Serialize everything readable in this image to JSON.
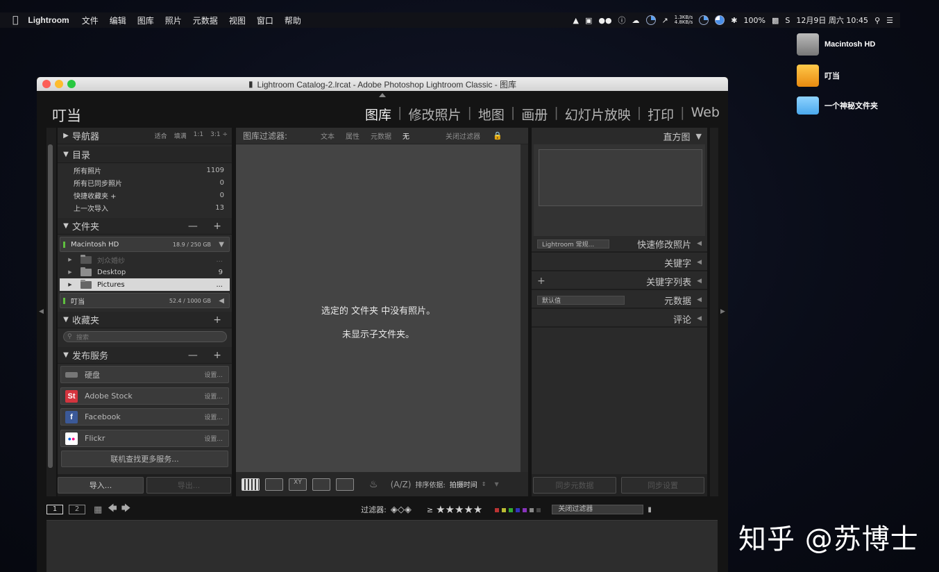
{
  "menubar": {
    "apple": "",
    "app_name": "Lightroom",
    "items": [
      "文件",
      "编辑",
      "图库",
      "照片",
      "元数据",
      "视图",
      "窗口",
      "帮助"
    ],
    "net_up": "1.3KB/s",
    "net_down": "4.8KB/s",
    "battery": "100%",
    "datetime": "12月9日 周六 10:45"
  },
  "desktop": {
    "icons": [
      {
        "label": "Macintosh HD",
        "icon": "hard-drive-icon"
      },
      {
        "label": "叮当",
        "icon": "external-drive-icon"
      },
      {
        "label": "一个神秘文件夹",
        "icon": "folder-icon"
      }
    ],
    "watermark": "知乎 @苏博士"
  },
  "window": {
    "title": "Lightroom Catalog-2.lrcat - Adobe Photoshop Lightroom Classic - 图库",
    "identity_plate": "叮当",
    "modules": [
      "图库",
      "修改照片",
      "地图",
      "画册",
      "幻灯片放映",
      "打印",
      "Web"
    ],
    "active_module": "图库"
  },
  "left_panel": {
    "navigator": {
      "title": "导航器",
      "options": [
        "适合",
        "填满",
        "1:1",
        "3:1 ÷"
      ]
    },
    "catalog": {
      "title": "目录",
      "rows": [
        {
          "label": "所有照片",
          "value": "1109"
        },
        {
          "label": "所有已同步照片",
          "value": "0"
        },
        {
          "label": "快捷收藏夹 +",
          "value": "0"
        },
        {
          "label": "上一次导入",
          "value": "13"
        }
      ]
    },
    "folders": {
      "title": "文件夹",
      "actions": "— +",
      "volume1": {
        "name": "Macintosh HD",
        "size": "18.9 / 250 GB"
      },
      "items": [
        {
          "name": "刘众婚纱",
          "count": "..."
        },
        {
          "name": "Desktop",
          "count": "9"
        },
        {
          "name": "Pictures",
          "count": "..."
        }
      ],
      "volume2": {
        "name": "叮当",
        "size": "52.4 / 1000 GB"
      }
    },
    "collections": {
      "title": "收藏夹",
      "action": "+",
      "search_placeholder": "搜索"
    },
    "publish": {
      "title": "发布服务",
      "actions": "— +",
      "services": [
        {
          "name": "硬盘",
          "setup": "设置..."
        },
        {
          "name": "Adobe Stock",
          "setup": "设置..."
        },
        {
          "name": "Facebook",
          "setup": "设置..."
        },
        {
          "name": "Flickr",
          "setup": "设置..."
        }
      ],
      "find_more": "联机查找更多服务..."
    },
    "import_label": "导入...",
    "export_label": "导出..."
  },
  "center": {
    "filter_label": "图库过滤器:",
    "filter_items": [
      "文本",
      "属性",
      "元数据",
      "无"
    ],
    "filter_off": "关闭过滤器",
    "message_line1": "选定的 文件夹 中没有照片。",
    "message_line2": "未显示子文件夹。",
    "sort_label": "排序依据:",
    "sort_value": "拍摄时间"
  },
  "right_panel": {
    "histogram": "直方图",
    "preset_select": "Lightroom 常规...",
    "quick_develop": "快速修改照片",
    "keywording": "关键字",
    "keyword_list": "关键字列表",
    "metadata_select": "默认值",
    "metadata": "元数据",
    "comments": "评论",
    "sync_metadata": "同步元数据",
    "sync_settings": "同步设置"
  },
  "filmstrip": {
    "page1": "1",
    "page2": "2",
    "filter_label": "过滤器:",
    "ge": "≥",
    "stars": "★★★★★",
    "filter_select": "关闭过滤器"
  },
  "colors": {
    "accent": "#4a8fe8",
    "panel": "#2a2a2a",
    "center": "#444444",
    "stock": "#d4343e",
    "facebook": "#3b5998"
  }
}
